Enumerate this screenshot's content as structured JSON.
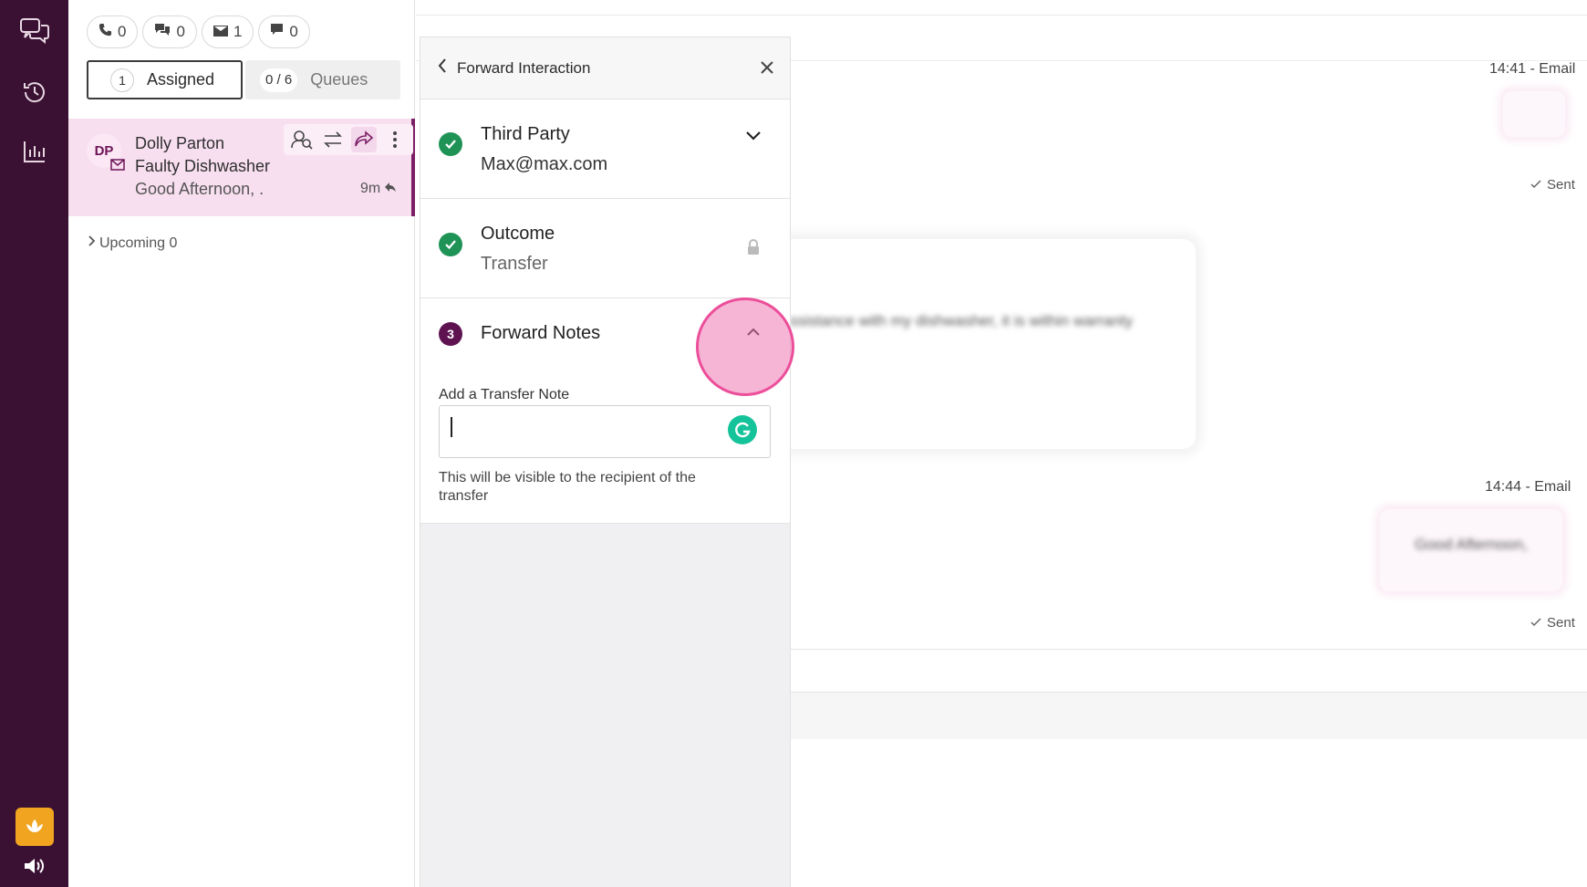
{
  "rail": {
    "items": [
      {
        "name": "chat-bubbles-icon"
      },
      {
        "name": "history-icon"
      },
      {
        "name": "reports-chart-icon"
      }
    ],
    "logo_icon": "flower-logo-icon",
    "speaker_icon": "speaker-icon"
  },
  "counters": [
    {
      "icon": "phone-icon",
      "value": "0"
    },
    {
      "icon": "chat-icon",
      "value": "0"
    },
    {
      "icon": "email-icon",
      "value": "1"
    },
    {
      "icon": "message-icon",
      "value": "0"
    }
  ],
  "tabs": {
    "assigned_count": "1",
    "assigned_label": "Assigned",
    "queues_count": "0 / 6",
    "queues_label": "Queues"
  },
  "interaction": {
    "initials": "DP",
    "name": "Dolly Parton",
    "subject": "Faulty Dishwasher",
    "preview": "Good Afternoon, .",
    "age": "9m"
  },
  "upcoming": {
    "label": "Upcoming 0"
  },
  "conversation": {
    "msg1_time": "14:41 - Email",
    "msg1_status": "Sent",
    "incoming_text": "ssistance with my dishwasher, it is within warranty",
    "msg2_time": "14:44 - Email",
    "msg2_status": "Sent",
    "outgoing_text": "Good Afternoon,"
  },
  "panel": {
    "title": "Forward Interaction",
    "steps": [
      {
        "title": "Third Party",
        "value": "Max@max.com",
        "state": "complete"
      },
      {
        "title": "Outcome",
        "value": "Transfer",
        "state": "complete"
      },
      {
        "number": "3",
        "title": "Forward Notes",
        "state": "active"
      }
    ],
    "note_label": "Add a Transfer Note",
    "note_value": "",
    "note_hint": "This will be visible to the recipient of the transfer"
  },
  "colors": {
    "rail": "#3a1132",
    "card_bg": "#f8dff0",
    "accent": "#7b1f66",
    "check": "#1f9356",
    "highlight": "#ec4f9a"
  }
}
